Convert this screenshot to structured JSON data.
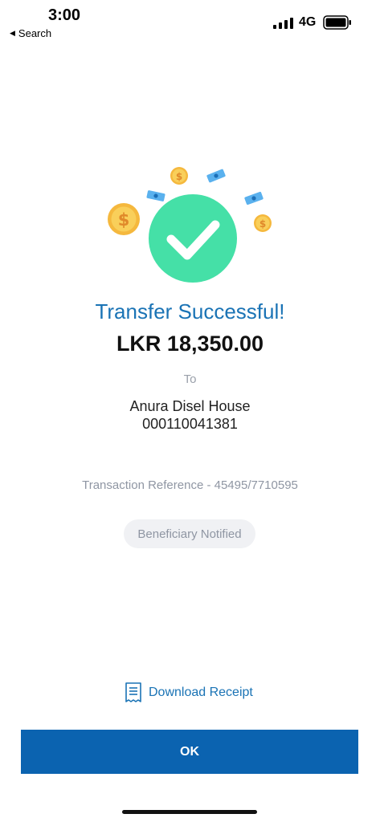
{
  "status_bar": {
    "time": "3:00",
    "back_label": "Search",
    "back_icon": "back-triangle-icon",
    "network": "4G"
  },
  "colors": {
    "accent": "#1a73b5",
    "button": "#0b63b0",
    "success": "#45e0a7",
    "coin": "#f7c948"
  },
  "result": {
    "title": "Transfer Successful!",
    "amount": "LKR 18,350.00",
    "to_label": "To",
    "recipient_name": "Anura Disel House",
    "recipient_account": "000110041381",
    "transaction_reference": "Transaction Reference - 45495/7710595",
    "badge": "Beneficiary Notified"
  },
  "actions": {
    "download_receipt": "Download Receipt",
    "download_icon": "receipt-icon",
    "ok": "OK"
  }
}
